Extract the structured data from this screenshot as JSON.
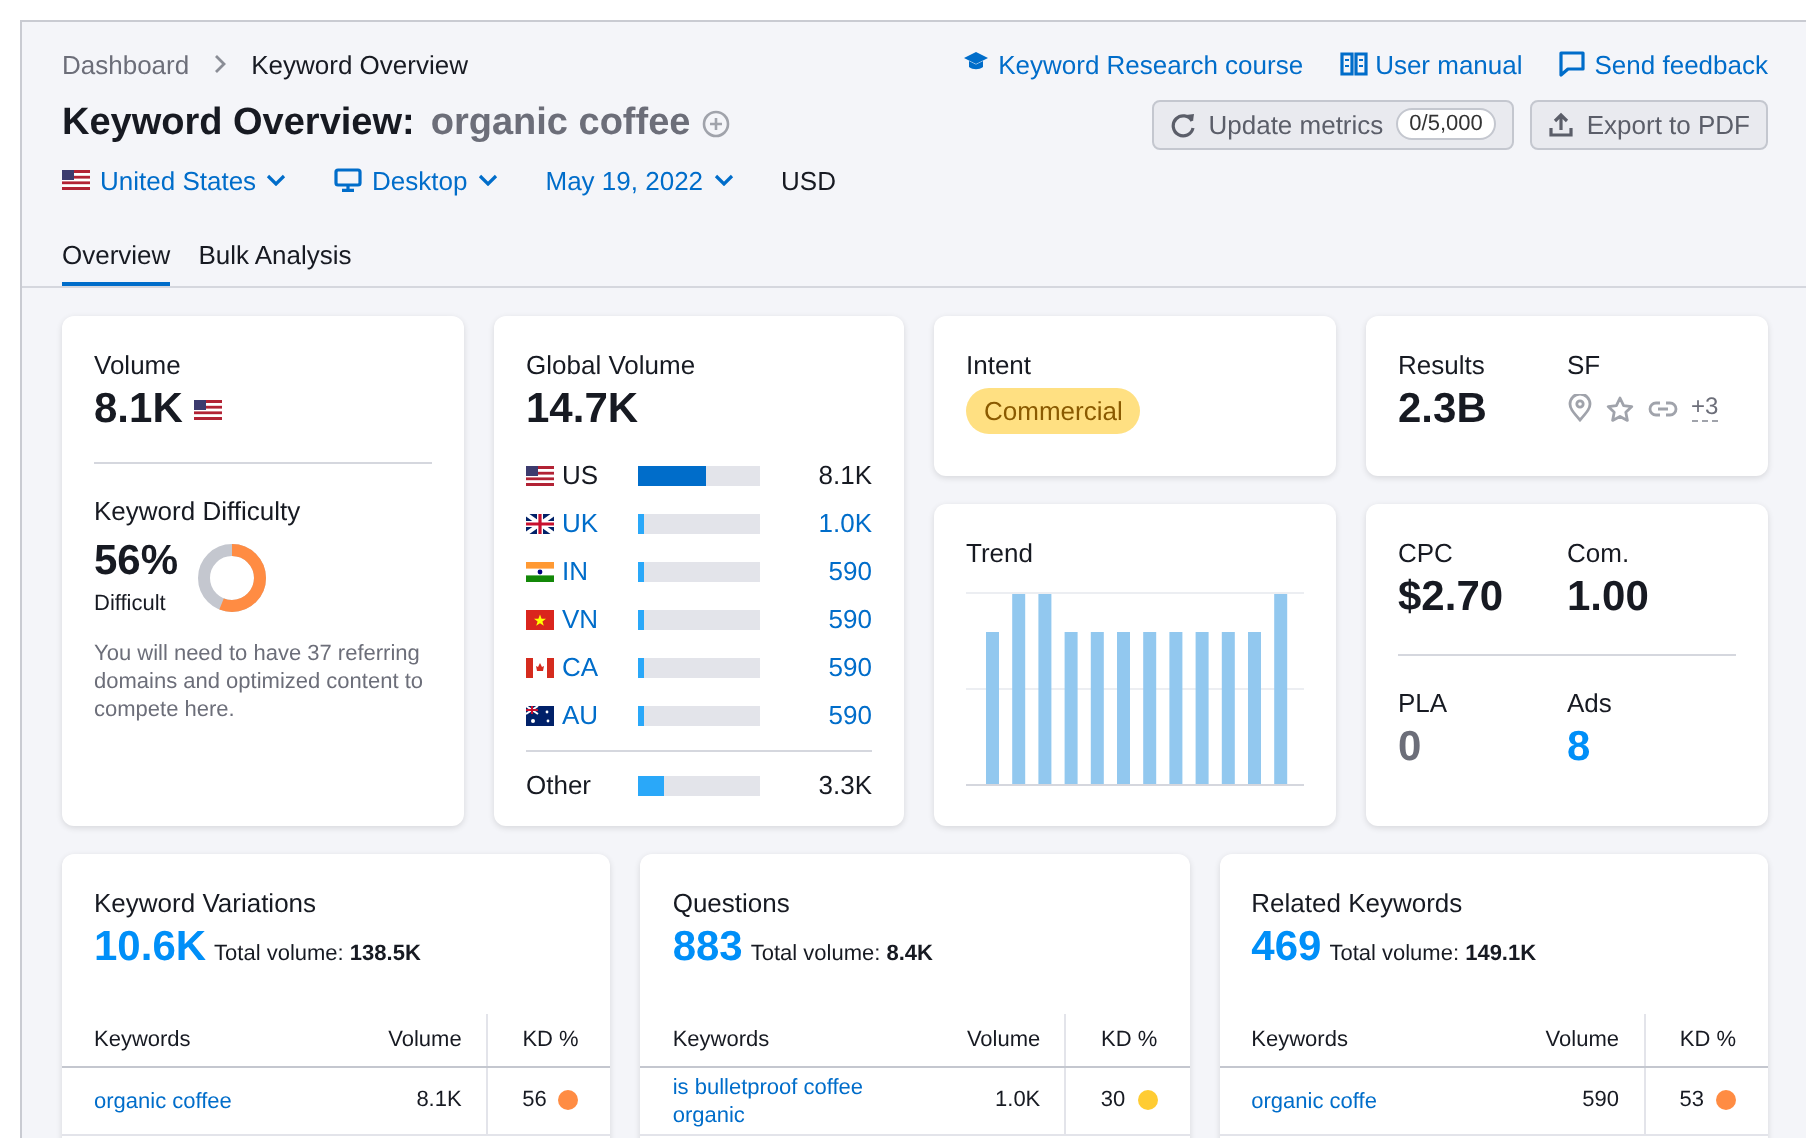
{
  "breadcrumb": [
    {
      "label": "Dashboard"
    },
    {
      "label": "Keyword Overview"
    }
  ],
  "header_links": [
    {
      "label": "Keyword Research course",
      "kind": "course"
    },
    {
      "label": "User manual",
      "kind": "manual"
    },
    {
      "label": "Send feedback",
      "kind": "feedback"
    }
  ],
  "title": {
    "label": "Keyword Overview:",
    "keyword": "organic coffee"
  },
  "buttons": [
    {
      "label": "Update metrics",
      "kind": "update",
      "counter": "0/5,000"
    },
    {
      "label": "Export to PDF",
      "kind": "export"
    }
  ],
  "filters": [
    {
      "label": "United States",
      "kind": "country"
    },
    {
      "label": "Desktop",
      "kind": "device"
    },
    {
      "label": "May 19, 2022",
      "kind": "date"
    },
    {
      "label": "USD",
      "kind": "currency"
    }
  ],
  "tabs": [
    {
      "label": "Overview",
      "selected": true
    },
    {
      "label": "Bulk Analysis",
      "selected": false
    }
  ],
  "volume": {
    "label": "Volume",
    "value": "8.1K"
  },
  "difficulty": {
    "label": "Keyword Difficulty",
    "value": "56%",
    "rating": "Difficult",
    "level": 0.56,
    "note": "You will need to have 37 referring domains and optimized content to compete here."
  },
  "global_volume": {
    "label": "Global Volume",
    "value": "14.7K",
    "countries": [
      {
        "code": "US",
        "kind": "us",
        "value": "8.1K",
        "level": 0.55,
        "selected": true
      },
      {
        "code": "UK",
        "kind": "uk",
        "value": "1.0K",
        "level": 0.05,
        "selected": false
      },
      {
        "code": "IN",
        "kind": "in",
        "value": "590",
        "level": 0.04,
        "selected": false
      },
      {
        "code": "VN",
        "kind": "vn",
        "value": "590",
        "level": 0.04,
        "selected": false
      },
      {
        "code": "CA",
        "kind": "ca",
        "value": "590",
        "level": 0.04,
        "selected": false
      },
      {
        "code": "AU",
        "kind": "au",
        "value": "590",
        "level": 0.04,
        "selected": false
      }
    ],
    "other": {
      "label": "Other",
      "value": "3.3K",
      "level": 0.21
    }
  },
  "intent": {
    "label": "Intent",
    "tag": "Commercial"
  },
  "results": {
    "label": "Results",
    "value": "2.3B"
  },
  "serp_features": {
    "label": "SF",
    "more": "+3"
  },
  "trend": {
    "label": "Trend"
  },
  "metrics": [
    {
      "label": "CPC",
      "value": "$2.70",
      "kind": "plain"
    },
    {
      "label": "Com.",
      "value": "1.00",
      "kind": "plain"
    },
    {
      "label": "PLA",
      "value": "0",
      "kind": "muted"
    },
    {
      "label": "Ads",
      "value": "8",
      "kind": "link"
    }
  ],
  "lists": [
    {
      "title": "Keyword Variations",
      "count": "10.6K",
      "total_label": "Total volume:",
      "total": "138.5K",
      "columns": [
        "Keywords",
        "Volume",
        "KD %"
      ],
      "rows": [
        {
          "keyword": "organic coffee",
          "volume": "8.1K",
          "kd": "56",
          "color": "#ff8c43"
        }
      ]
    },
    {
      "title": "Questions",
      "count": "883",
      "total_label": "Total volume:",
      "total": "8.4K",
      "columns": [
        "Keywords",
        "Volume",
        "KD %"
      ],
      "rows": [
        {
          "keyword": "is bulletproof coffee organic",
          "volume": "1.0K",
          "kd": "30",
          "color": "#ffcc33"
        }
      ]
    },
    {
      "title": "Related Keywords",
      "count": "469",
      "total_label": "Total volume:",
      "total": "149.1K",
      "columns": [
        "Keywords",
        "Volume",
        "KD %"
      ],
      "rows": [
        {
          "keyword": "organic coffe",
          "volume": "590",
          "kd": "53",
          "color": "#ff8c43"
        }
      ]
    }
  ]
}
